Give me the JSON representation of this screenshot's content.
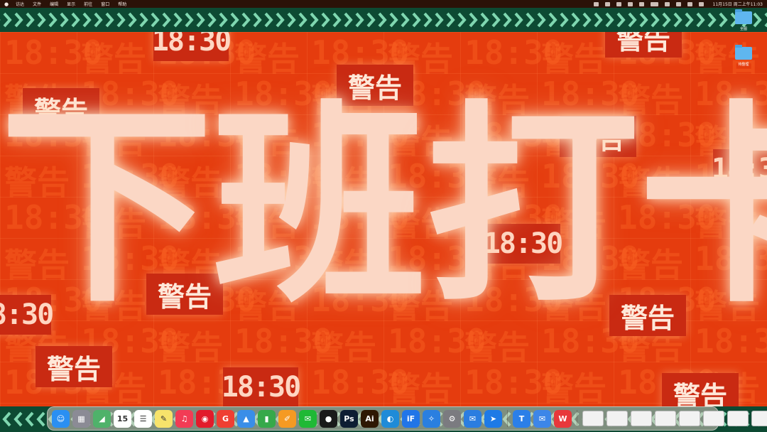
{
  "menubar": {
    "apple_icon": "",
    "items": [
      "访达",
      "文件",
      "编辑",
      "显示",
      "前往",
      "窗口",
      "帮助"
    ],
    "status_icons": [
      "wechat-icon",
      "bluetooth-icon",
      "box-icon",
      "lock-icon",
      "flag-icon",
      "battery-icon",
      "wifi-icon",
      "search-icon",
      "control-center-icon",
      "siri-icon"
    ],
    "clock": "11月15日 周二上午11:03"
  },
  "wallpaper": {
    "headline": [
      "下",
      "班",
      "打",
      "卡"
    ],
    "warn": "警告",
    "time": "18:30",
    "bg_word_warn": "警告",
    "bg_word_time": "18:30"
  },
  "desktop": {
    "items": [
      {
        "label": "全图",
        "icon": "folder-icon"
      },
      {
        "label": "待整理",
        "icon": "folder-icon"
      }
    ]
  },
  "dock": {
    "apps": [
      {
        "name": "finder",
        "glyph": "☺",
        "color": "#2a8ff2"
      },
      {
        "name": "launchpad",
        "glyph": "▦",
        "color": "#8b8b95"
      },
      {
        "name": "maps",
        "glyph": "◢",
        "color": "#4fb26a"
      },
      {
        "name": "calendar",
        "glyph": "15",
        "color": "#ffffff"
      },
      {
        "name": "reminders",
        "glyph": "☰",
        "color": "#ffffff"
      },
      {
        "name": "notes",
        "glyph": "✎",
        "color": "#f7e36b"
      },
      {
        "name": "music",
        "glyph": "♫",
        "color": "#f23c55"
      },
      {
        "name": "netease-music",
        "glyph": "◉",
        "color": "#e21b2b"
      },
      {
        "name": "quicktime",
        "glyph": "G",
        "color": "#ef3f32"
      },
      {
        "name": "keynote",
        "glyph": "▲",
        "color": "#3a8ee8"
      },
      {
        "name": "numbers",
        "glyph": "▮",
        "color": "#36a94a"
      },
      {
        "name": "pages",
        "glyph": "✐",
        "color": "#f59a23"
      },
      {
        "name": "wechat",
        "glyph": "✉",
        "color": "#1fb935"
      },
      {
        "name": "qq",
        "glyph": "●",
        "color": "#1a1a1a"
      },
      {
        "name": "photoshop",
        "glyph": "Ps",
        "color": "#0e1d33"
      },
      {
        "name": "illustrator",
        "glyph": "Ai",
        "color": "#2e1803"
      },
      {
        "name": "edge",
        "glyph": "◐",
        "color": "#1f8bd8"
      },
      {
        "name": "ifonts",
        "glyph": "iF",
        "color": "#2175e8"
      },
      {
        "name": "safari",
        "glyph": "✧",
        "color": "#2a7fe0"
      },
      {
        "name": "system-settings",
        "glyph": "⚙",
        "color": "#7b7b80"
      },
      {
        "name": "mail",
        "glyph": "✉",
        "color": "#2b7de0"
      },
      {
        "name": "pointer-app",
        "glyph": "➤",
        "color": "#1e7ae6"
      },
      {
        "name": "tencent-meeting",
        "glyph": "T",
        "color": "#2b7fe8"
      },
      {
        "name": "mail-2",
        "glyph": "✉",
        "color": "#3d86e8"
      },
      {
        "name": "wps",
        "glyph": "W",
        "color": "#e8383b"
      }
    ],
    "thumbs": 8,
    "trash": "trash-icon"
  }
}
